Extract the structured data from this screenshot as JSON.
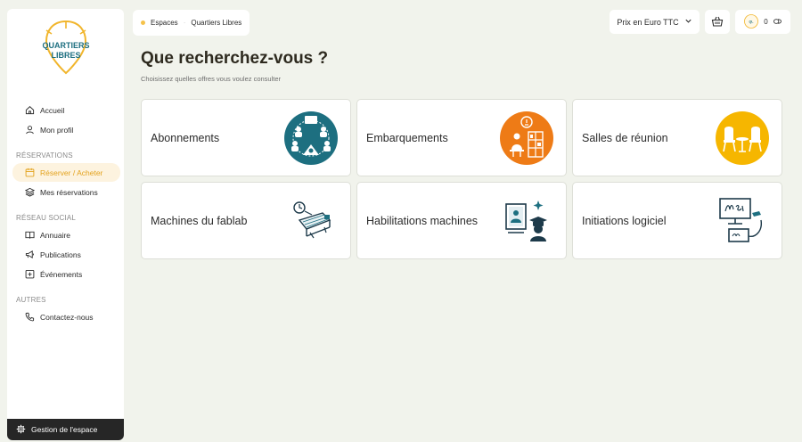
{
  "logo": {
    "lines": [
      "QUARTIERS",
      "LIBRES"
    ]
  },
  "sidebar": {
    "top_items": [
      {
        "label": "Accueil",
        "icon": "home-icon"
      },
      {
        "label": "Mon profil",
        "icon": "user-icon"
      }
    ],
    "sections": [
      {
        "title": "RÉSERVATIONS",
        "items": [
          {
            "label": "Réserver / Acheter",
            "icon": "calendar-icon",
            "active": true
          },
          {
            "label": "Mes réservations",
            "icon": "layers-icon"
          }
        ]
      },
      {
        "title": "RÉSEAU SOCIAL",
        "items": [
          {
            "label": "Annuaire",
            "icon": "book-icon"
          },
          {
            "label": "Publications",
            "icon": "megaphone-icon"
          },
          {
            "label": "Événements",
            "icon": "event-plus-icon"
          }
        ]
      },
      {
        "title": "AUTRES",
        "items": [
          {
            "label": "Contactez-nous",
            "icon": "phone-icon"
          }
        ]
      }
    ],
    "footer_label": "Gestion de l'espace"
  },
  "breadcrumb": {
    "items": [
      "Espaces",
      "Quartiers Libres"
    ]
  },
  "topbar": {
    "currency_label": "Prix en Euro TTC",
    "credits": "0"
  },
  "main": {
    "title": "Que recherchez-vous ?",
    "subtitle": "Choisissez quelles offres vous voulez consulter",
    "cards": [
      {
        "label": "Abonnements",
        "icon": "team-coworking-icon"
      },
      {
        "label": "Embarquements",
        "icon": "office-desk-icon"
      },
      {
        "label": "Salles de réunion",
        "icon": "meeting-chairs-icon"
      },
      {
        "label": "Machines du fablab",
        "icon": "laser-machine-icon"
      },
      {
        "label": "Habilitations machines",
        "icon": "graduate-training-icon"
      },
      {
        "label": "Initiations logiciel",
        "icon": "software-screen-icon"
      }
    ]
  },
  "colors": {
    "accent": "#e3a21c",
    "teal": "#1d6f80",
    "orange": "#ee7b16",
    "yellow": "#f6b600",
    "background": "#f1f3ec"
  }
}
